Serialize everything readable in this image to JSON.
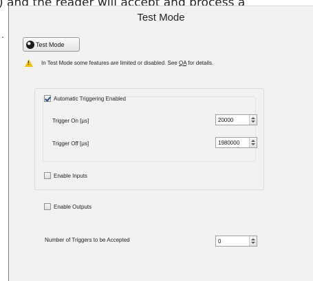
{
  "document": {
    "text_fragment": ") and the reader will accept and process a",
    "bullet_fragment": "."
  },
  "window": {
    "title": "Test Mode"
  },
  "toolbar": {
    "test_mode_button": "Test Mode"
  },
  "warning": {
    "text_before": "In Test Mode some features are limited or disabled. See ",
    "link_text": "QA",
    "text_after": " for details."
  },
  "triggering": {
    "auto_label": "Automatic Triggering Enabled",
    "auto_checked": true,
    "trigger_on_label": "Trigger On [µs]",
    "trigger_on_value": "20000",
    "trigger_off_label": "Trigger Off [µs]",
    "trigger_off_value": "1980000"
  },
  "inputs": {
    "enable_label": "Enable Inputs",
    "checked": false
  },
  "outputs": {
    "enable_label": "Enable Outputs",
    "checked": false
  },
  "triggers_accepted": {
    "label": "Number of Triggers to be Accepted",
    "value": "0"
  },
  "icons": {
    "test_mode": "test-mode-icon",
    "warning": "warning-icon",
    "checkbox": "checkbox-icon",
    "spin_up": "spin-up-icon",
    "spin_down": "spin-down-icon"
  }
}
